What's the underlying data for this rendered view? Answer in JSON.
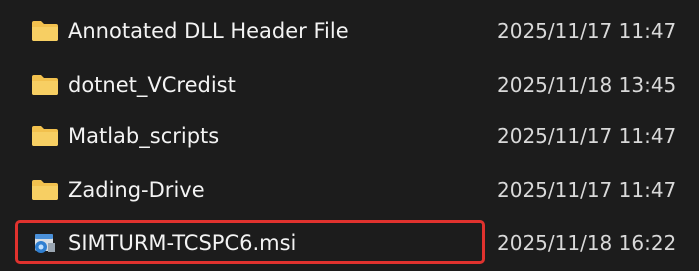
{
  "files": [
    {
      "name": "Annotated DLL Header File",
      "date": "2025/11/17 11:47",
      "icon": "folder-icon"
    },
    {
      "name": "dotnet_VCredist",
      "date": "2025/11/18 13:45",
      "icon": "folder-icon"
    },
    {
      "name": "Matlab_scripts",
      "date": "2025/11/17 11:47",
      "icon": "folder-icon"
    },
    {
      "name": "Zading-Drive",
      "date": "2025/11/17 11:47",
      "icon": "folder-icon"
    },
    {
      "name": "SIMTURM-TCSPC6.msi",
      "date": "2025/11/18 16:22",
      "icon": "msi-installer-icon"
    }
  ],
  "colors": {
    "background": "#1c1c1c",
    "folder": "#f2c14e",
    "highlight": "#e0322e"
  }
}
